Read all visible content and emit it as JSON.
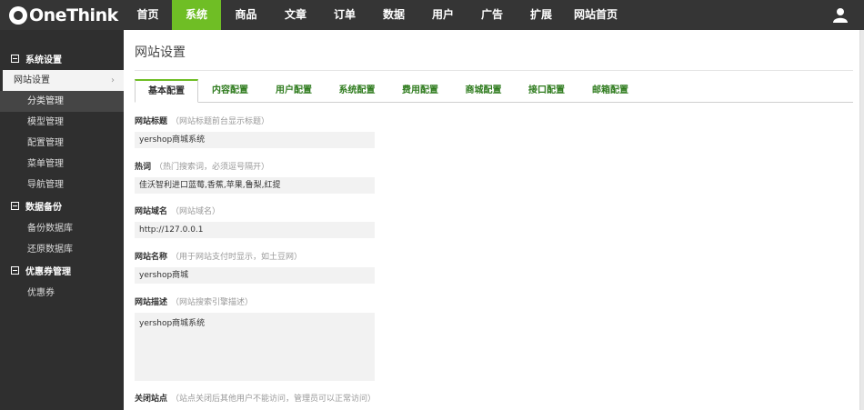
{
  "brand": {
    "name": "OneThink"
  },
  "nav": {
    "items": [
      {
        "label": "首页"
      },
      {
        "label": "系统"
      },
      {
        "label": "商品"
      },
      {
        "label": "文章"
      },
      {
        "label": "订单"
      },
      {
        "label": "数据"
      },
      {
        "label": "用户"
      },
      {
        "label": "广告"
      },
      {
        "label": "扩展"
      },
      {
        "label": "网站首页"
      }
    ],
    "active_index": 1,
    "user_icon": "user-icon"
  },
  "sidebar": {
    "groups": [
      {
        "label": "系统设置",
        "items": [
          {
            "label": "网站设置"
          },
          {
            "label": "分类管理"
          },
          {
            "label": "模型管理"
          },
          {
            "label": "配置管理"
          },
          {
            "label": "菜单管理"
          },
          {
            "label": "导航管理"
          }
        ]
      },
      {
        "label": "数据备份",
        "items": [
          {
            "label": "备份数据库"
          },
          {
            "label": "还原数据库"
          }
        ]
      },
      {
        "label": "优惠券管理",
        "items": [
          {
            "label": "优惠券"
          }
        ]
      }
    ]
  },
  "main": {
    "title": "网站设置",
    "tabs": [
      {
        "label": "基本配置"
      },
      {
        "label": "内容配置"
      },
      {
        "label": "用户配置"
      },
      {
        "label": "系统配置"
      },
      {
        "label": "费用配置"
      },
      {
        "label": "商城配置"
      },
      {
        "label": "接口配置"
      },
      {
        "label": "邮箱配置"
      }
    ],
    "active_tab": 0,
    "fields": [
      {
        "label": "网站标题",
        "hint": "（网站标题前台显示标题）",
        "value": "yershop商城系统"
      },
      {
        "label": "热词",
        "hint": "（热门搜索词，必须逗号隔开）",
        "value": "佳沃智利进口蓝莓,香蕉,苹果,鲁梨,红提"
      },
      {
        "label": "网站域名",
        "hint": "（网站域名）",
        "value": "http://127.0.0.1"
      },
      {
        "label": "网站名称",
        "hint": "（用于网站支付时显示，如土豆网）",
        "value": "yershop商城"
      },
      {
        "label": "网站描述",
        "hint": "（网站搜索引擎描述）",
        "value": "yershop商城系统"
      },
      {
        "label": "关闭站点",
        "hint": "（站点关闭后其他用户不能访问，管理员可以正常访问）"
      }
    ]
  },
  "colors": {
    "accent": "#6fbe25",
    "topbar": "#353535",
    "sidebar": "#2f2f2f"
  }
}
